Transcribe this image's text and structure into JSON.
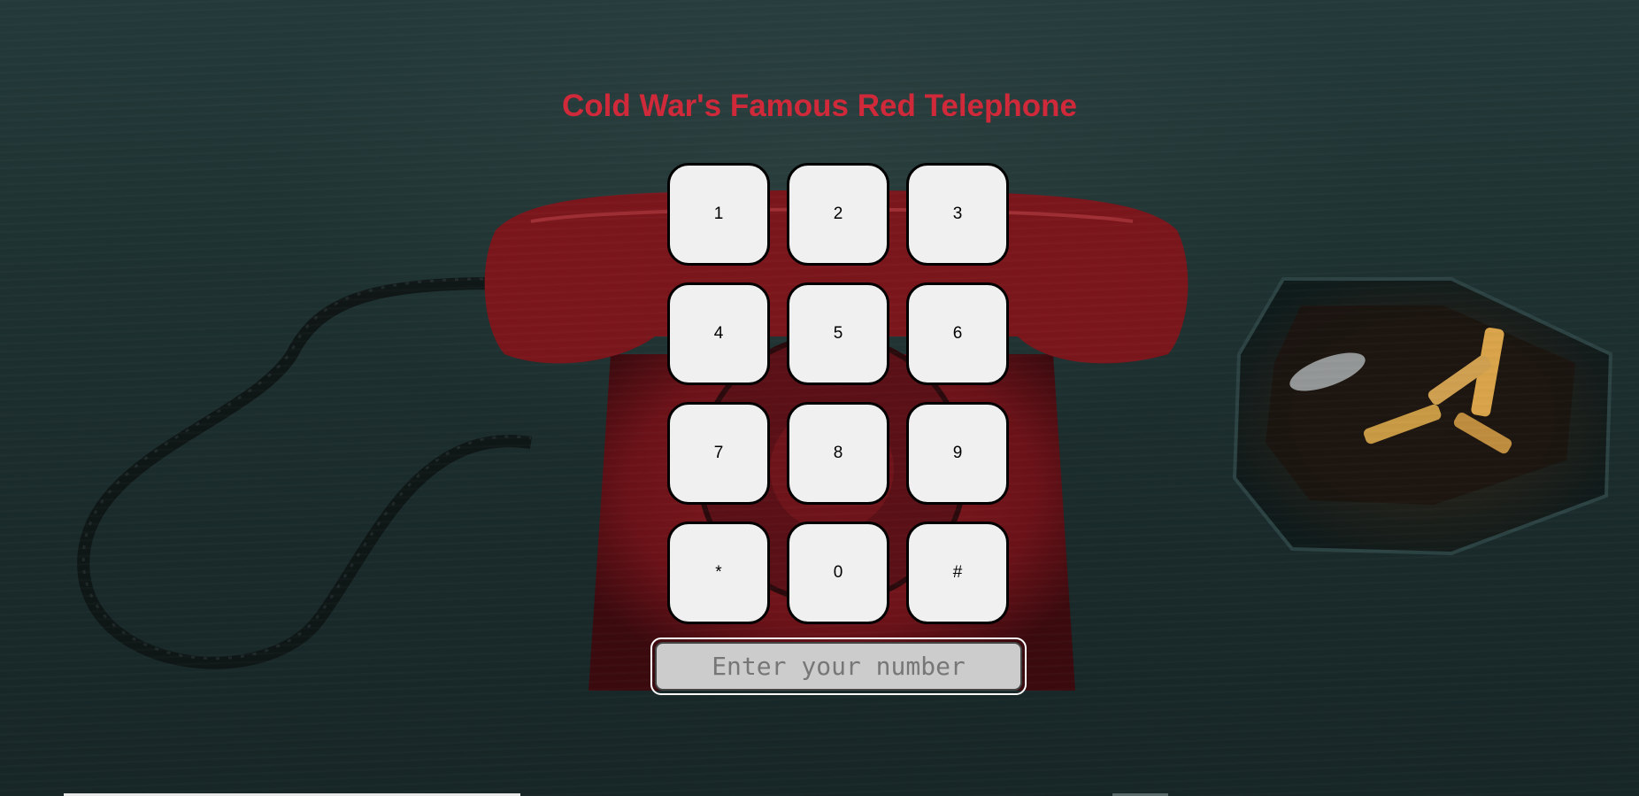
{
  "page": {
    "title": "Cold War's Famous Red Telephone",
    "title_color": "#d0293a",
    "background_image": "red-rotary-telephone-with-ashtray"
  },
  "keypad": {
    "keys": [
      "1",
      "2",
      "3",
      "4",
      "5",
      "6",
      "7",
      "8",
      "9",
      "*",
      "0",
      "#"
    ]
  },
  "number_input": {
    "value": "",
    "placeholder": "Enter your number"
  }
}
